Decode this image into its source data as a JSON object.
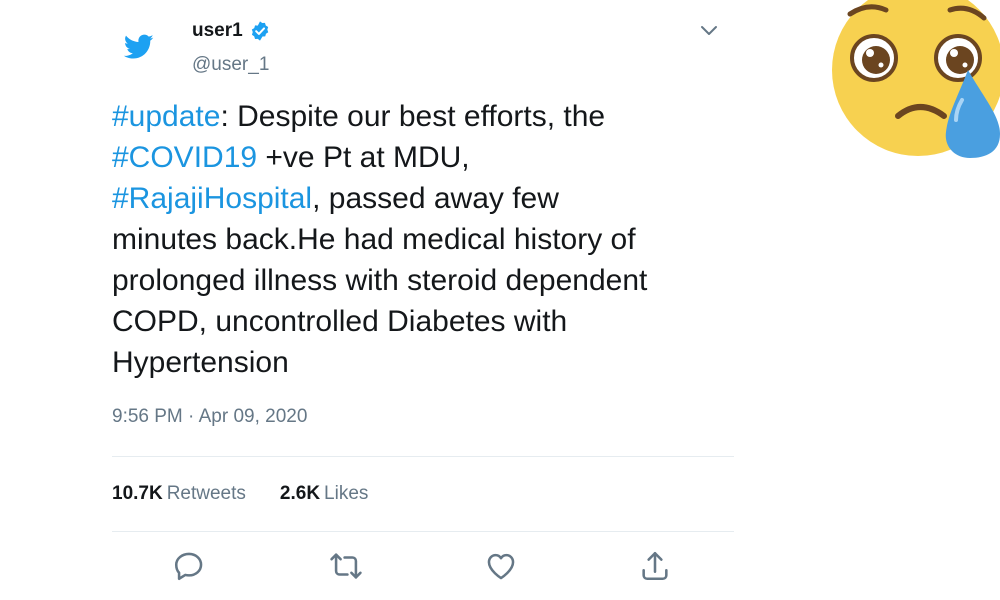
{
  "user": {
    "display_name": "user1",
    "handle": "@user_1"
  },
  "tweet": {
    "lines": [
      [
        {
          "text": "#update",
          "hashtag": true
        },
        {
          "text": ": Despite our best efforts, the",
          "hashtag": false
        }
      ],
      [
        {
          "text": "#COVID19",
          "hashtag": true
        },
        {
          "text": " +ve Pt at MDU,",
          "hashtag": false
        }
      ],
      [
        {
          "text": "#RajajiHospital",
          "hashtag": true
        },
        {
          "text": ", passed away few",
          "hashtag": false
        }
      ],
      [
        {
          "text": "minutes back.He had medical history of",
          "hashtag": false
        }
      ],
      [
        {
          "text": "prolonged illness with steroid dependent",
          "hashtag": false
        }
      ],
      [
        {
          "text": "COPD, uncontrolled Diabetes with",
          "hashtag": false
        }
      ],
      [
        {
          "text": "Hypertension",
          "hashtag": false
        }
      ]
    ],
    "timestamp": "9:56 PM · Apr 09, 2020"
  },
  "stats": {
    "retweets_count": "10.7K",
    "retweets_label": "Retweets",
    "likes_count": "2.6K",
    "likes_label": "Likes"
  },
  "icons": {
    "brand": "twitter-bird-icon",
    "verified": "verified-badge-icon",
    "menu": "chevron-down-icon",
    "reply": "reply-icon",
    "retweet": "retweet-icon",
    "like": "heart-icon",
    "share": "share-icon",
    "emoji": "crying-face-emoji"
  },
  "colors": {
    "brand_blue": "#1da1f2",
    "hashtag_blue": "#1b95e0",
    "text": "#14171a",
    "secondary_text": "#657786",
    "divider": "#e6ecf0",
    "emoji_yellow": "#f7d150",
    "tear_blue": "#4a9fe0"
  }
}
